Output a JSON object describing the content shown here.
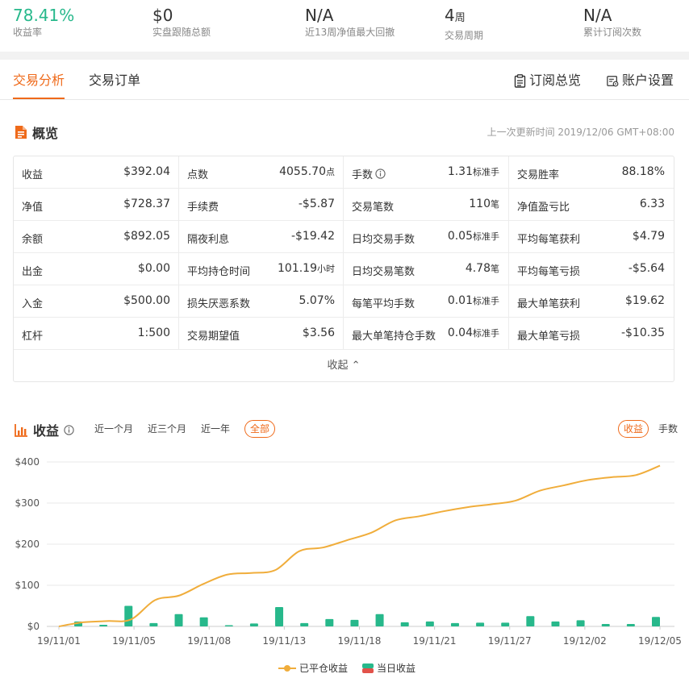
{
  "stats": [
    {
      "value": "78.41%",
      "label": "收益率",
      "unit": ""
    },
    {
      "value": "$0",
      "label": "实盘跟随总额",
      "unit": ""
    },
    {
      "value": "N/A",
      "label": "近13周净值最大回撤",
      "unit": ""
    },
    {
      "value": "4",
      "label": "交易周期",
      "unit": "周"
    },
    {
      "value": "N/A",
      "label": "累计订阅次数",
      "unit": ""
    }
  ],
  "tabs": {
    "analysis": "交易分析",
    "orders": "交易订单"
  },
  "links": {
    "subscription": "订阅总览",
    "account": "账户设置"
  },
  "overview": {
    "title": "概览",
    "updated": "上一次更新时间 2019/12/06 GMT+08:00",
    "collapse": "收起",
    "rows": [
      [
        {
          "k": "收益",
          "v": "$392.04",
          "u": ""
        },
        {
          "k": "点数",
          "v": "4055.70",
          "u": "点"
        },
        {
          "k": "手数",
          "v": "1.31",
          "u": "标准手",
          "info": true
        },
        {
          "k": "交易胜率",
          "v": "88.18%",
          "u": ""
        }
      ],
      [
        {
          "k": "净值",
          "v": "$728.37",
          "u": ""
        },
        {
          "k": "手续费",
          "v": "-$5.87",
          "u": ""
        },
        {
          "k": "交易笔数",
          "v": "110",
          "u": "笔"
        },
        {
          "k": "净值盈亏比",
          "v": "6.33",
          "u": ""
        }
      ],
      [
        {
          "k": "余额",
          "v": "$892.05",
          "u": ""
        },
        {
          "k": "隔夜利息",
          "v": "-$19.42",
          "u": ""
        },
        {
          "k": "日均交易手数",
          "v": "0.05",
          "u": "标准手"
        },
        {
          "k": "平均每笔获利",
          "v": "$4.79",
          "u": ""
        }
      ],
      [
        {
          "k": "出金",
          "v": "$0.00",
          "u": ""
        },
        {
          "k": "平均持仓时间",
          "v": "101.19",
          "u": "小时"
        },
        {
          "k": "日均交易笔数",
          "v": "4.78",
          "u": "笔"
        },
        {
          "k": "平均每笔亏损",
          "v": "-$5.64",
          "u": ""
        }
      ],
      [
        {
          "k": "入金",
          "v": "$500.00",
          "u": ""
        },
        {
          "k": "损失厌恶系数",
          "v": "5.07%",
          "u": ""
        },
        {
          "k": "每笔平均手数",
          "v": "0.01",
          "u": "标准手"
        },
        {
          "k": "最大单笔获利",
          "v": "$19.62",
          "u": ""
        }
      ],
      [
        {
          "k": "杠杆",
          "v": "1:500",
          "u": ""
        },
        {
          "k": "交易期望值",
          "v": "$3.56",
          "u": ""
        },
        {
          "k": "最大单笔持仓手数",
          "v": "0.04",
          "u": "标准手"
        },
        {
          "k": "最大单笔亏损",
          "v": "-$10.35",
          "u": ""
        }
      ]
    ]
  },
  "profit_section": {
    "title": "收益",
    "filters": [
      "近一个月",
      "近三个月",
      "近一年",
      "全部"
    ],
    "active_filter": "全部",
    "pills": [
      "收益",
      "手数"
    ],
    "active_pill": "收益"
  },
  "colors": {
    "accent": "#ef6a1a",
    "green": "#27b88b",
    "line": "#f0ad3b"
  },
  "chart_data": {
    "type": "line",
    "x_ticks": [
      "19/11/01",
      "19/11/05",
      "19/11/08",
      "19/11/13",
      "19/11/18",
      "19/11/21",
      "19/11/27",
      "19/12/02",
      "19/12/05"
    ],
    "y_ticks": [
      "$0",
      "$100",
      "$200",
      "$300",
      "$400"
    ],
    "ylim": [
      0,
      400
    ],
    "legend": [
      "已平仓收益",
      "当日收益"
    ],
    "series": [
      {
        "name": "已平仓收益",
        "type": "line",
        "values": [
          0,
          10,
          13,
          17,
          64,
          75,
          103,
          126,
          130,
          137,
          183,
          192,
          210,
          228,
          258,
          268,
          280,
          290,
          297,
          306,
          330,
          343,
          356,
          363,
          368,
          391
        ]
      },
      {
        "name": "当日收益",
        "type": "bar",
        "values": [
          12,
          4,
          50,
          8,
          30,
          22,
          3,
          7,
          47,
          8,
          18,
          16,
          30,
          10,
          12,
          8,
          9,
          9,
          25,
          12,
          15,
          6,
          6,
          23
        ]
      }
    ]
  }
}
